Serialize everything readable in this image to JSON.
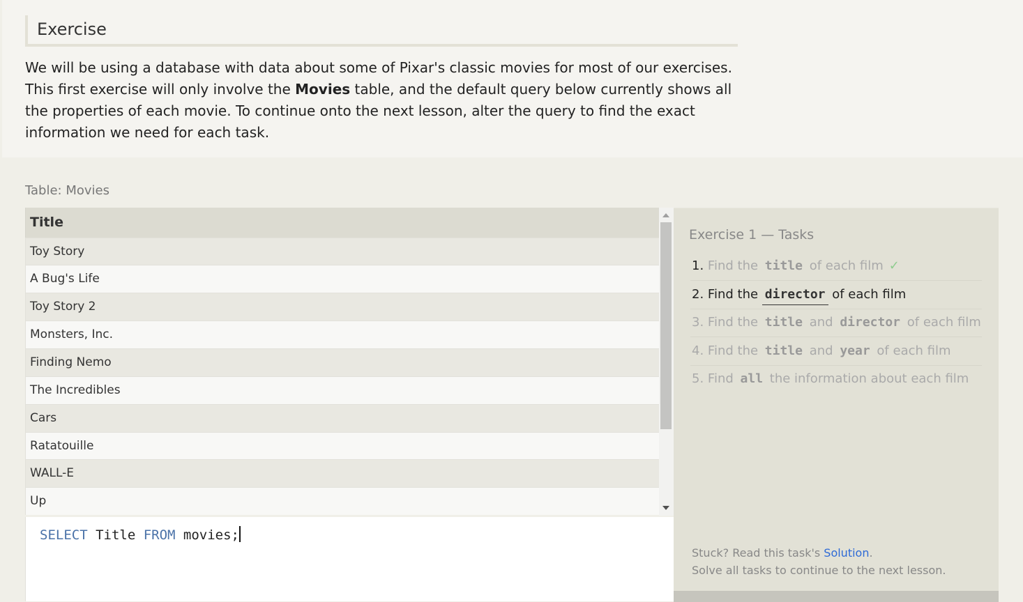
{
  "exercise": {
    "heading": "Exercise",
    "intro_part1": "We will be using a database with data about some of Pixar's classic movies for most of our exercises. This first exercise will only involve the ",
    "intro_bold": "Movies",
    "intro_part2": " table, and the default query below currently shows all the properties of each movie. To continue onto the next lesson, alter the query to find the exact information we need for each task."
  },
  "table": {
    "label": "Table: Movies",
    "column_header": "Title",
    "rows": [
      "Toy Story",
      "A Bug's Life",
      "Toy Story 2",
      "Monsters, Inc.",
      "Finding Nemo",
      "The Incredibles",
      "Cars",
      "Ratatouille",
      "WALL-E",
      "Up"
    ]
  },
  "scrollbar": {
    "position_fraction": 0.0,
    "visible_fraction": 0.7
  },
  "editor": {
    "kw_select": "SELECT",
    "col": " Title ",
    "kw_from": "FROM",
    "rest": " movies;"
  },
  "tasks": {
    "title": "Exercise 1 — Tasks",
    "items": [
      {
        "num": "1.",
        "pre": "Find the",
        "code1": "title",
        "mid": "",
        "code2": "",
        "post": "of each film",
        "state": "done",
        "check": "✓"
      },
      {
        "num": "2.",
        "pre": "Find the",
        "code1": "director",
        "mid": "",
        "code2": "",
        "post": "of each film",
        "state": "active"
      },
      {
        "num": "3.",
        "pre": "Find the",
        "code1": "title",
        "mid": "and",
        "code2": "director",
        "post": "of each film",
        "state": "pending"
      },
      {
        "num": "4.",
        "pre": "Find the",
        "code1": "title",
        "mid": "and",
        "code2": "year",
        "post": "of each film",
        "state": "pending"
      },
      {
        "num": "5.",
        "pre": "Find",
        "code1": "all",
        "mid": "",
        "code2": "",
        "post": "the information about each film",
        "state": "pending"
      }
    ],
    "help_prefix": "Stuck? Read this task's ",
    "help_link": "Solution",
    "help_suffix": ".",
    "help_line2": "Solve all tasks to continue to the next lesson."
  },
  "colors": {
    "link": "#2e6ad6",
    "keyword": "#4a72a8",
    "check": "#8fcc8f"
  }
}
